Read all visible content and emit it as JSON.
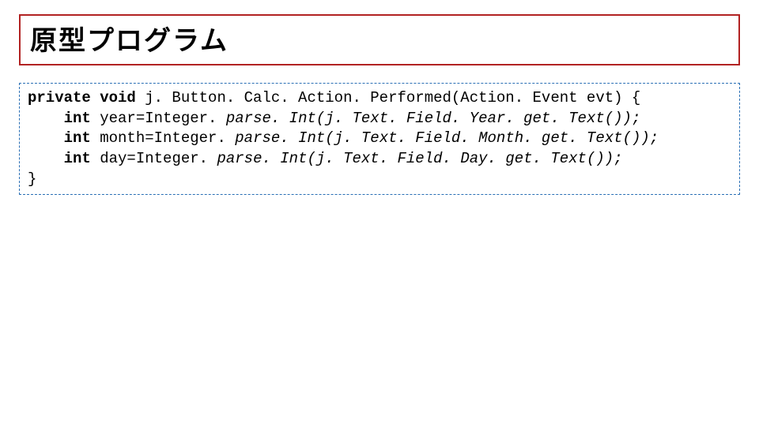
{
  "title": "原型プログラム",
  "code": {
    "l1": {
      "kw": "private void",
      "rest": " j. Button. Calc. Action. Performed(Action. Event evt) {"
    },
    "l2": {
      "indent": "    ",
      "kw": "int",
      "rest": " year=Integer.",
      "ital": " parse. Int(j. Text. Field. Year. get. Text());"
    },
    "l3": {
      "indent": "    ",
      "kw": "int",
      "rest": " month=Integer.",
      "ital": " parse. Int(j. Text. Field. Month. get. Text());"
    },
    "l4": {
      "indent": "    ",
      "kw": "int",
      "rest": " day=Integer.",
      "ital": " parse. Int(j. Text. Field. Day. get. Text());"
    },
    "l5": "}"
  }
}
